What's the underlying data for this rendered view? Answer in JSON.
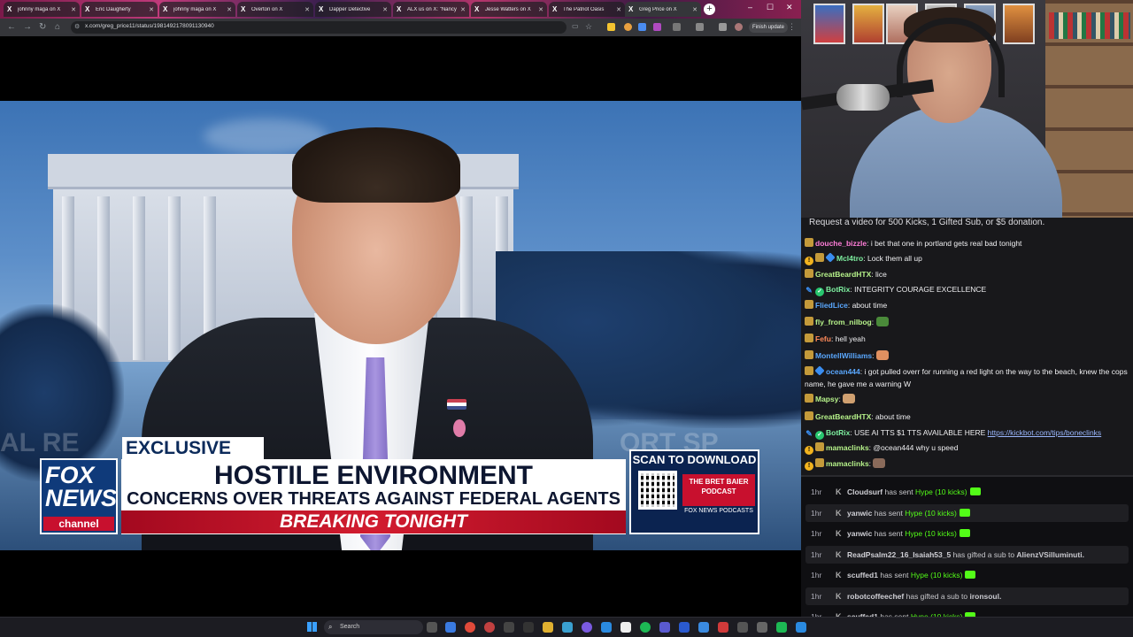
{
  "browser": {
    "tabs": [
      {
        "title": "johnny maga on X"
      },
      {
        "title": "Eric Daugherty"
      },
      {
        "title": "johnny maga on X"
      },
      {
        "title": "Overton on X"
      },
      {
        "title": "Dapper Detective"
      },
      {
        "title": "ALX us on X: \"Nancy"
      },
      {
        "title": "Jesse Watters on X"
      },
      {
        "title": "The Patriot Oasis"
      },
      {
        "title": "Greg Price on X"
      }
    ],
    "url": "x.com/greg_price11/status/1981492178091130940",
    "update_label": "Finish update"
  },
  "video": {
    "exclusive": "EXCLUSIVE",
    "headline": "HOSTILE ENVIRONMENT",
    "subline": "CONCERNS OVER THREATS AGAINST FEDERAL AGENTS",
    "breaking": "BREAKING TONIGHT",
    "logo_top": "FOX",
    "logo_bottom": "NEWS",
    "logo_channel": "channel",
    "promo_scan": "SCAN TO DOWNLOAD",
    "promo_podcast": "THE BRET BAIER PODCAST",
    "promo_sub": "FOX NEWS PODCASTS",
    "bg_text_left": "AL RE",
    "bg_text_right": "ORT SP"
  },
  "chat": {
    "banner": "Request a video for 500 Kicks, 1 Gifted Sub, or $5 donation.",
    "messages": [
      {
        "badges": [
          "sub"
        ],
        "user": "douche_bizzle",
        "color": "#ff7dd8",
        "text": "i bet that one in portland gets real bad tonight"
      },
      {
        "badges": [
          "yellow",
          "sub",
          "blue"
        ],
        "user": "Mcl4tro",
        "color": "#7ef0a0",
        "text": "Lock them all up"
      },
      {
        "badges": [
          "sub"
        ],
        "user": "GreatBeardHTX",
        "color": "#b6f28a",
        "text": "lice"
      },
      {
        "badges": [
          "pen",
          "green"
        ],
        "user": "BotRix",
        "color": "#7ef0a0",
        "text": "INTEGRITY COURAGE EXCELLENCE"
      },
      {
        "badges": [
          "sub"
        ],
        "user": "FliedLice",
        "color": "#5aa8ff",
        "text": "about time"
      },
      {
        "badges": [
          "sub"
        ],
        "user": "fly_from_nilbog",
        "color": "#b6f28a",
        "text": ""
      },
      {
        "badges": [
          "sub"
        ],
        "user": "Fefu",
        "color": "#ff8a5a",
        "text": "hell yeah"
      },
      {
        "badges": [
          "sub"
        ],
        "user": "MontellWilliams",
        "color": "#5aa8ff",
        "text": ""
      },
      {
        "badges": [
          "sub",
          "blue"
        ],
        "user": "ocean444",
        "color": "#5aa8ff",
        "text": "i got pulled overr for running a red light on the way to the beach, knew the cops name, he gave me a warning W"
      },
      {
        "badges": [
          "sub"
        ],
        "user": "Mapsy",
        "color": "#b6f28a",
        "text": ""
      },
      {
        "badges": [
          "sub"
        ],
        "user": "GreatBeardHTX",
        "color": "#b6f28a",
        "text": "about time"
      },
      {
        "badges": [
          "pen",
          "green"
        ],
        "user": "BotRix",
        "color": "#7ef0a0",
        "text": "USE AI TTS $1 TTS AVAILABLE HERE ",
        "link": "https://kickbot.com/tips/boneclinks"
      },
      {
        "badges": [
          "yellow",
          "sub"
        ],
        "user": "mamaclinks",
        "color": "#b6f28a",
        "text": "@ocean444 why u speed"
      },
      {
        "badges": [
          "yellow",
          "sub"
        ],
        "user": "mamaclinks",
        "color": "#b6f28a",
        "text": ""
      }
    ]
  },
  "feed": {
    "events": [
      {
        "time": "1hr",
        "user": "Cloudsurf",
        "action": "has sent",
        "what": "Hype (10 kicks)",
        "type": "hype"
      },
      {
        "time": "1hr",
        "user": "yanwic",
        "action": "has sent",
        "what": "Hype (10 kicks)",
        "type": "hype"
      },
      {
        "time": "1hr",
        "user": "yanwic",
        "action": "has sent",
        "what": "Hype (10 kicks)",
        "type": "hype"
      },
      {
        "time": "1hr",
        "user": "ReadPsalm22_16_Isaiah53_5",
        "action": "has gifted a sub to",
        "what": "AlienzVSilluminuti.",
        "type": "gift"
      },
      {
        "time": "1hr",
        "user": "scuffed1",
        "action": "has sent",
        "what": "Hype (10 kicks)",
        "type": "hype"
      },
      {
        "time": "1hr",
        "user": "robotcoffeechef",
        "action": "has gifted a sub to",
        "what": "ironsoul.",
        "type": "gift"
      },
      {
        "time": "1hr",
        "user": "scuffed1",
        "action": "has sent",
        "what": "Hype (10 kicks)",
        "type": "hype"
      }
    ]
  },
  "taskbar": {
    "search_label": "Search"
  }
}
